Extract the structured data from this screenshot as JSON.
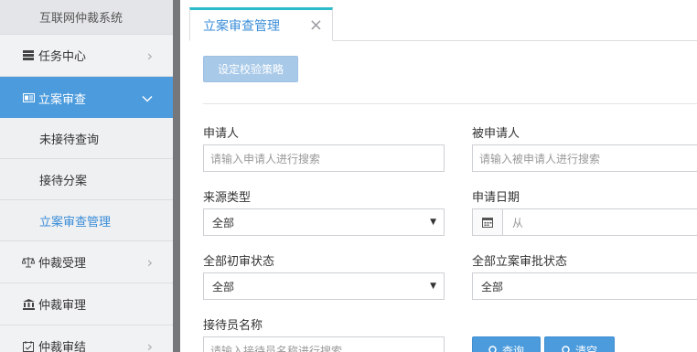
{
  "sidebar": {
    "top_label": "互联网仲裁系统",
    "items": [
      {
        "label": "任务中心",
        "icon": "task-icon"
      },
      {
        "label": "立案审查",
        "icon": "case-review-icon"
      },
      {
        "label": "仲裁受理",
        "icon": "scale-icon"
      },
      {
        "label": "仲裁审理",
        "icon": "court-icon"
      },
      {
        "label": "仲裁审结",
        "icon": "calendar-check-icon"
      }
    ],
    "subitems": [
      {
        "label": "未接待查询"
      },
      {
        "label": "接待分案"
      },
      {
        "label": "立案审查管理"
      }
    ]
  },
  "tabs": [
    {
      "label": "立案审查管理"
    }
  ],
  "toolbar": {
    "strategy_label": "设定校验策略"
  },
  "form": {
    "applicant": {
      "label": "申请人",
      "placeholder": "请输入申请人进行搜索"
    },
    "respondent": {
      "label": "被申请人",
      "placeholder": "请输入被申请人进行搜索"
    },
    "source_type": {
      "label": "来源类型",
      "value": "全部"
    },
    "apply_date": {
      "label": "申请日期",
      "from_placeholder": "从"
    },
    "initial_review_status": {
      "label": "全部初审状态",
      "value": "全部"
    },
    "approval_status": {
      "label": "全部立案审批状态",
      "value": "全部"
    },
    "receptionist": {
      "label": "接待员名称",
      "placeholder": "请输入接待员名称进行搜索"
    }
  },
  "actions": {
    "query_label": "查询",
    "clear_label": "清空"
  },
  "colors": {
    "accent": "#4b9bdd",
    "tab_top": "#2bbbc9",
    "sidebar_bg": "#f1f2f4",
    "divider": "#76777b"
  }
}
